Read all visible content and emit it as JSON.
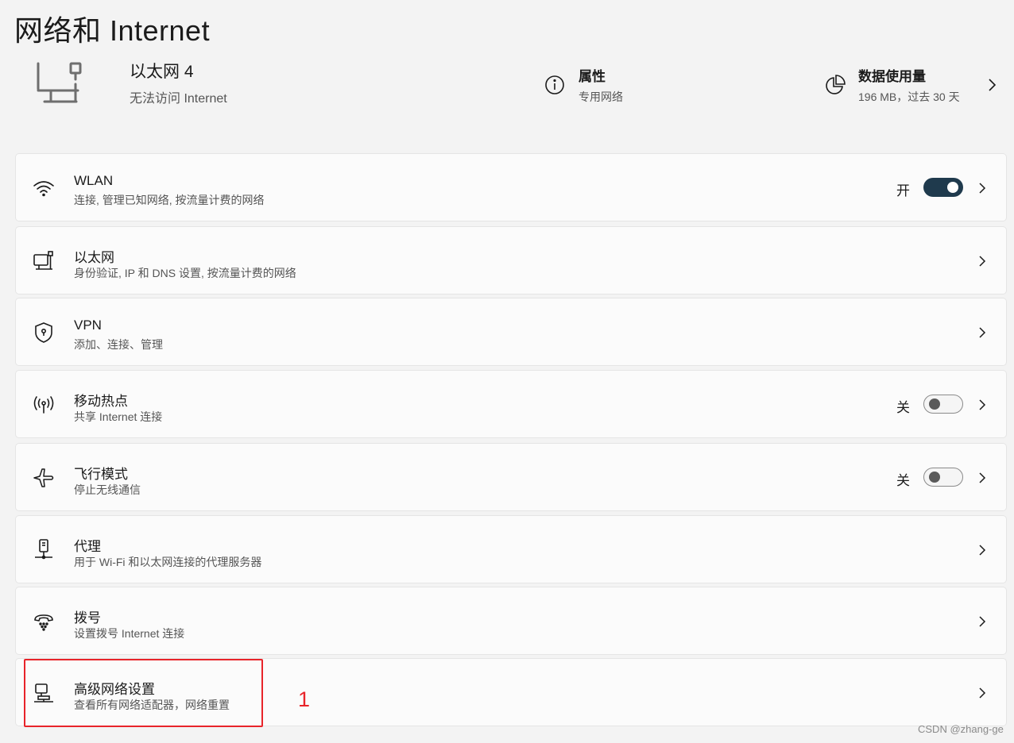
{
  "page": {
    "title": "网络和 Internet"
  },
  "header": {
    "adapter_name": "以太网 4",
    "adapter_status": "无法访问 Internet",
    "properties": {
      "title": "属性",
      "subtitle": "专用网络",
      "icon": "info-icon"
    },
    "data_usage": {
      "title": "数据使用量",
      "subtitle": "196 MB，过去 30 天",
      "icon": "pie-chart-icon"
    }
  },
  "cards": [
    {
      "id": "wlan",
      "icon": "wifi-icon",
      "title": "WLAN",
      "subtitle": "连接, 管理已知网络, 按流量计费的网络",
      "state": "开",
      "toggle": "on"
    },
    {
      "id": "ethernet",
      "icon": "ethernet-icon",
      "title": "以太网",
      "subtitle": "身份验证, IP 和 DNS 设置, 按流量计费的网络"
    },
    {
      "id": "vpn",
      "icon": "shield-icon",
      "title": "VPN",
      "subtitle": "添加、连接、管理"
    },
    {
      "id": "hotspot",
      "icon": "hotspot-icon",
      "title": "移动热点",
      "subtitle": "共享 Internet 连接",
      "state": "关",
      "toggle": "off"
    },
    {
      "id": "airplane",
      "icon": "airplane-icon",
      "title": "飞行模式",
      "subtitle": "停止无线通信",
      "state": "关",
      "toggle": "off"
    },
    {
      "id": "proxy",
      "icon": "proxy-icon",
      "title": "代理",
      "subtitle": "用于 Wi-Fi 和以太网连接的代理服务器"
    },
    {
      "id": "dialup",
      "icon": "phone-icon",
      "title": "拨号",
      "subtitle": "设置拨号 Internet 连接"
    },
    {
      "id": "advanced",
      "icon": "network-adapter-icon",
      "title": "高级网络设置",
      "subtitle": "查看所有网络适配器，网络重置"
    }
  ],
  "annotation": {
    "label": "1",
    "color": "#e8242a"
  },
  "watermark": "CSDN @zhang-ge",
  "colors": {
    "toggle_on": "#1f3a4d",
    "background": "#f3f3f3",
    "card": "#fbfbfb",
    "annotation": "#e8242a"
  }
}
